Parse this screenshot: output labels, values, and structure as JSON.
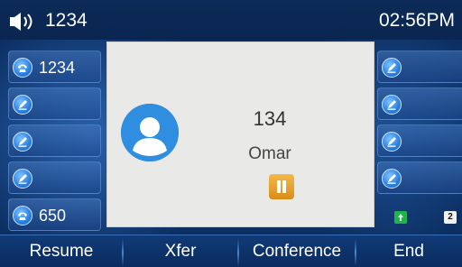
{
  "status_bar": {
    "line_label": "1234",
    "time": "02:56PM"
  },
  "line_keys_left": [
    {
      "icon": "phone-handset-icon",
      "label": "1234"
    },
    {
      "icon": "edit-pen-icon",
      "label": ""
    },
    {
      "icon": "edit-pen-icon",
      "label": ""
    },
    {
      "icon": "edit-pen-icon",
      "label": ""
    },
    {
      "icon": "phone-handset-icon",
      "label": "650"
    }
  ],
  "line_keys_right": [
    {
      "icon": "edit-pen-icon",
      "label": ""
    },
    {
      "icon": "edit-pen-icon",
      "label": ""
    },
    {
      "icon": "edit-pen-icon",
      "label": ""
    },
    {
      "icon": "edit-pen-icon",
      "label": ""
    }
  ],
  "call": {
    "number": "134",
    "name": "Omar",
    "state_icon": "hold-pause-icon"
  },
  "pages": {
    "current": "1",
    "next": "2"
  },
  "softkeys": {
    "resume": "Resume",
    "xfer": "Xfer",
    "conference": "Conference",
    "end": "End"
  },
  "colors": {
    "background": "#0b2a5a",
    "popup": "#e9e9e7",
    "hold_accent": "#e8a12e",
    "avatar": "#2f8ee0",
    "page_active": "#22b24c"
  }
}
